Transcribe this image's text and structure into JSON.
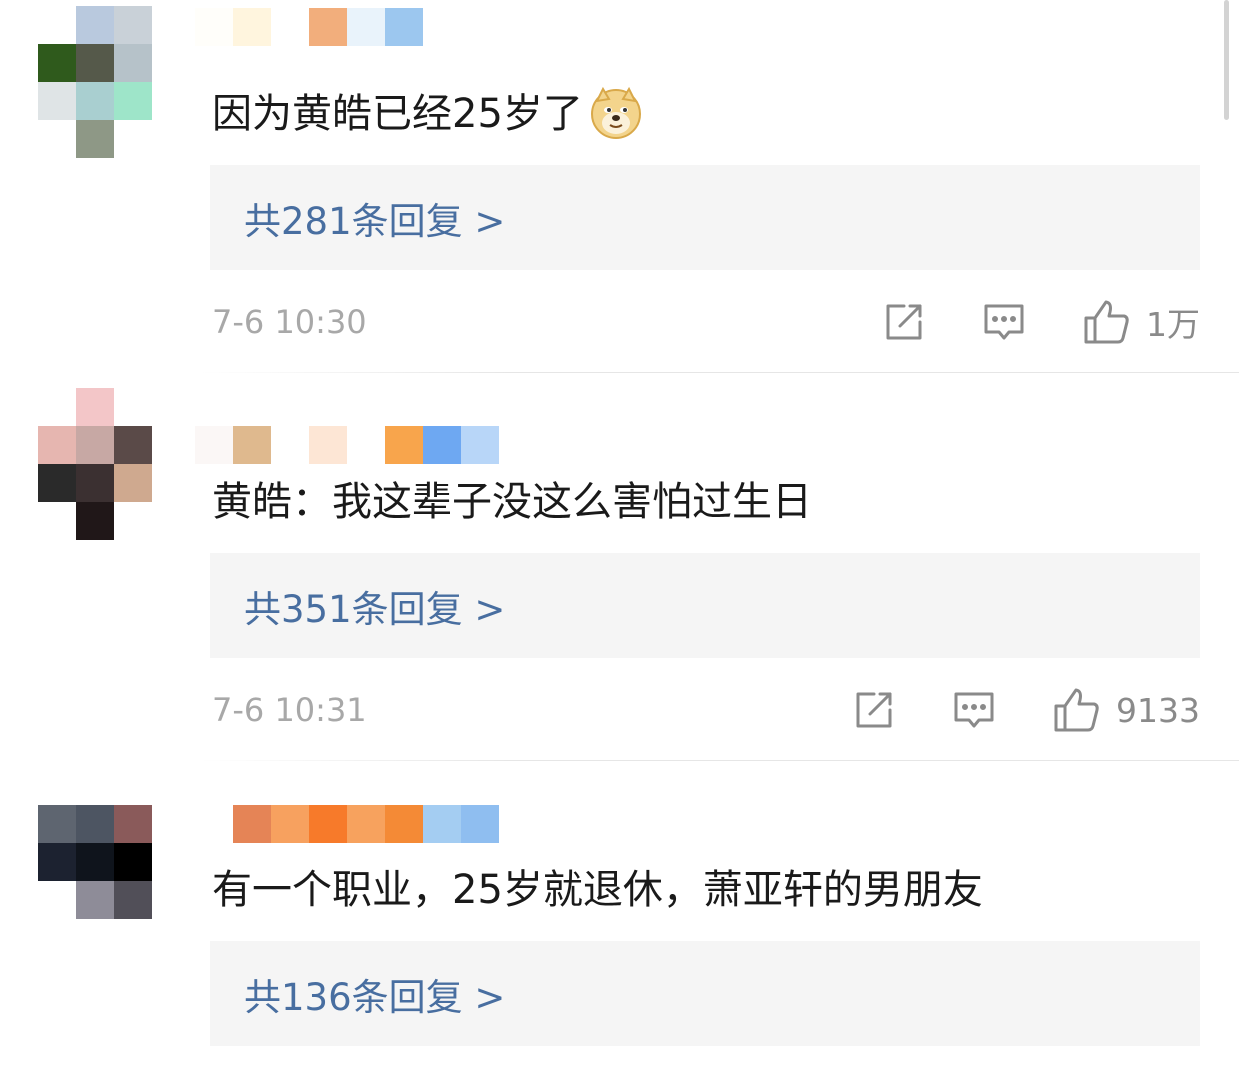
{
  "comments": [
    {
      "text": "因为黄皓已经25岁了",
      "reply_label": "共281条回复 >",
      "time": "7-6 10:30",
      "likes": "1万",
      "has_emoji": true,
      "emoji": "doge-emoji"
    },
    {
      "text": "黄皓：我这辈子没这么害怕过生日",
      "reply_label": "共351条回复 >",
      "time": "7-6 10:31",
      "likes": "9133"
    },
    {
      "text": "有一个职业，25岁就退休，萧亚轩的男朋友",
      "reply_label": "共136条回复 >"
    }
  ],
  "icons": {
    "repost": "repost-icon",
    "comment": "comment-icon",
    "like": "thumbs-up-icon"
  },
  "colors": {
    "reply_link": "#486ea0",
    "reply_bg": "#f5f5f5",
    "meta_gray": "#a8a8a8"
  }
}
